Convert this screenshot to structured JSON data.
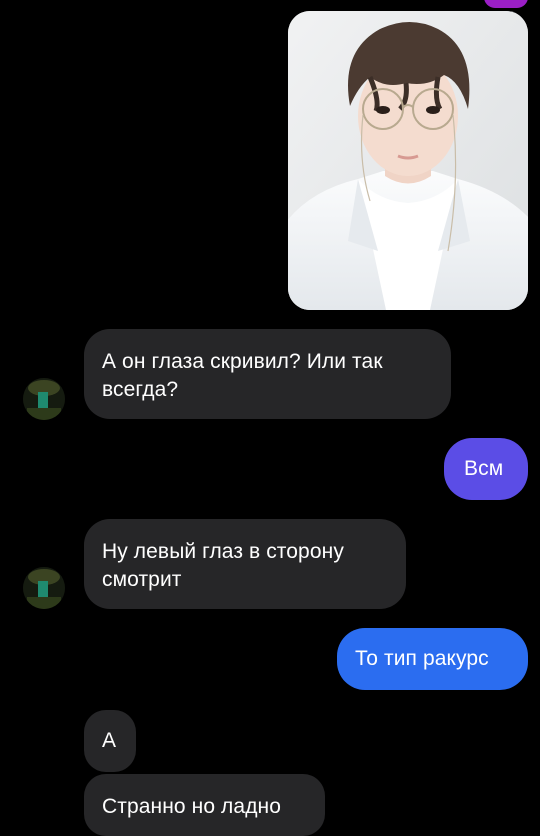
{
  "conversation": {
    "photo_message": {
      "icon": "photo-person-with-glasses"
    },
    "messages": [
      {
        "from": "them",
        "text": "А он глаза скривил? Или так всегда?"
      },
      {
        "from": "me",
        "text": "Всм"
      },
      {
        "from": "them",
        "text": "Ну левый глаз в сторону смотрит"
      },
      {
        "from": "me",
        "text": "То тип ракурс"
      },
      {
        "from": "them",
        "text": "А"
      },
      {
        "from": "them",
        "text": "Странно но ладно"
      }
    ]
  },
  "colors": {
    "background": "#000000",
    "incoming_bubble": "#262628",
    "outgoing_bubble_purple": "#5b4de6",
    "outgoing_bubble_blue": "#2b6df0",
    "top_bubble_sliver": "#9b1fc6"
  }
}
